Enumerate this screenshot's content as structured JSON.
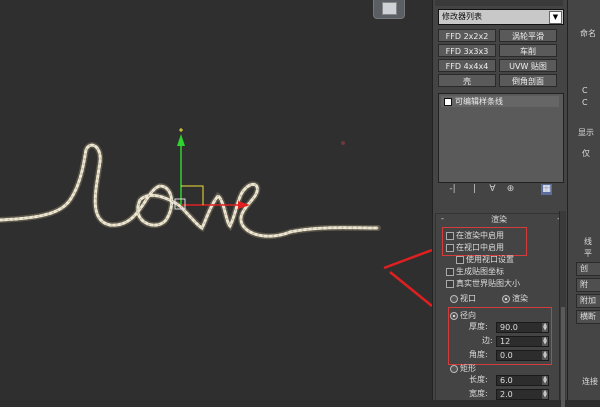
{
  "modifier_panel": {
    "modifier_list": "修改器列表",
    "buttons": [
      "FFD 2x2x2",
      "涡轮平滑",
      "FFD 3x3x3",
      "车削",
      "FFD 4x4x4",
      "UVW 贴图",
      "壳",
      "倒角剖面"
    ],
    "stack_item": "可编辑样条线",
    "stack_tools": [
      "-|",
      "|",
      "∀",
      "⊕",
      "▦"
    ]
  },
  "render_rollout": {
    "header": "渲染",
    "header_plus": "-",
    "enable_in_renderer": "在渲染中启用",
    "enable_in_viewport": "在视口中启用",
    "use_viewport_settings": "使用视口设置",
    "generate_mapping_coords": "生成贴图坐标",
    "real_world_map_size": "真实世界贴图大小",
    "mode_viewport": "视口",
    "mode_render": "渲染",
    "radial": "径向",
    "thickness_label": "厚度:",
    "thickness_value": "90.0",
    "sides_label": "边:",
    "sides_value": "12",
    "angle_label": "角度:",
    "angle_value": "0.0",
    "rectangular": "矩形",
    "length_label": "长度:",
    "length_value": "6.0",
    "width_label": "宽度:",
    "width_value": "2.0"
  },
  "side_panel": {
    "naming": "命名",
    "items": [
      "C",
      "C",
      "显示",
      "仅"
    ],
    "buttons": [
      "创",
      "附",
      "附加",
      "横断"
    ],
    "radio_labels": [
      "线",
      "平"
    ],
    "bottom": [
      "连接"
    ]
  },
  "colors": {
    "highlight_red": "#d63b3b",
    "spline_rope": "#ece6d2",
    "gizmo_green": "#2fd32f",
    "gizmo_red": "#e02020",
    "gizmo_yellow": "#f0e23a"
  }
}
